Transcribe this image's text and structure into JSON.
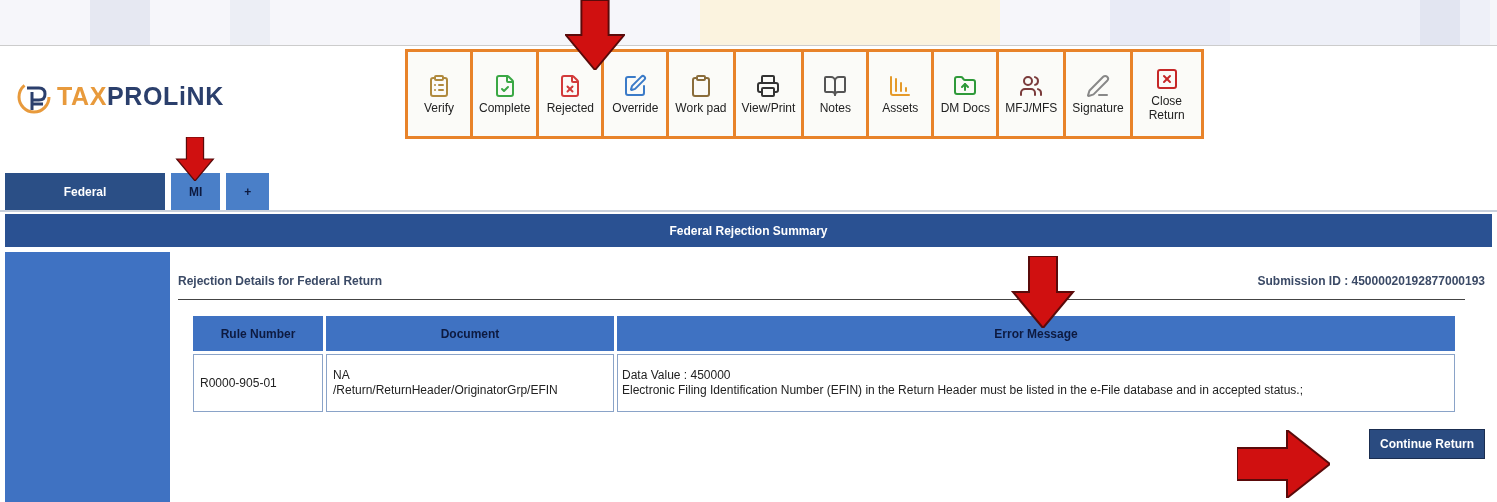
{
  "logo": {
    "text_a": "TAX",
    "text_b": "PROLiNK"
  },
  "toolbar": [
    {
      "label": "Verify"
    },
    {
      "label": "Complete"
    },
    {
      "label": "Rejected"
    },
    {
      "label": "Override"
    },
    {
      "label": "Work pad"
    },
    {
      "label": "View/Print"
    },
    {
      "label": "Notes"
    },
    {
      "label": "Assets"
    },
    {
      "label": "DM Docs"
    },
    {
      "label": "MFJ/MFS"
    },
    {
      "label": "Signature"
    },
    {
      "label": "Close Return"
    }
  ],
  "tabs": [
    {
      "label": "Federal",
      "selected": true
    },
    {
      "label": "MI",
      "selected": false
    },
    {
      "label": "+",
      "selected": false
    }
  ],
  "title_bar": "Federal Rejection Summary",
  "details_heading": "Rejection Details for Federal Return",
  "submission_id": "Submission ID : 45000020192877000193",
  "table": {
    "columns": [
      "Rule Number",
      "Document",
      "Error Message"
    ],
    "rows": [
      {
        "rule_number": "R0000-905-01",
        "document": [
          "NA",
          "/Return/ReturnHeader/OriginatorGrp/EFIN"
        ],
        "error_message": [
          "Data Value : 450000",
          "Electronic Filing Identification Number (EFIN) in the Return Header must be listed in the e-File database and in accepted status.;"
        ]
      }
    ]
  },
  "continue_button": "Continue Return"
}
